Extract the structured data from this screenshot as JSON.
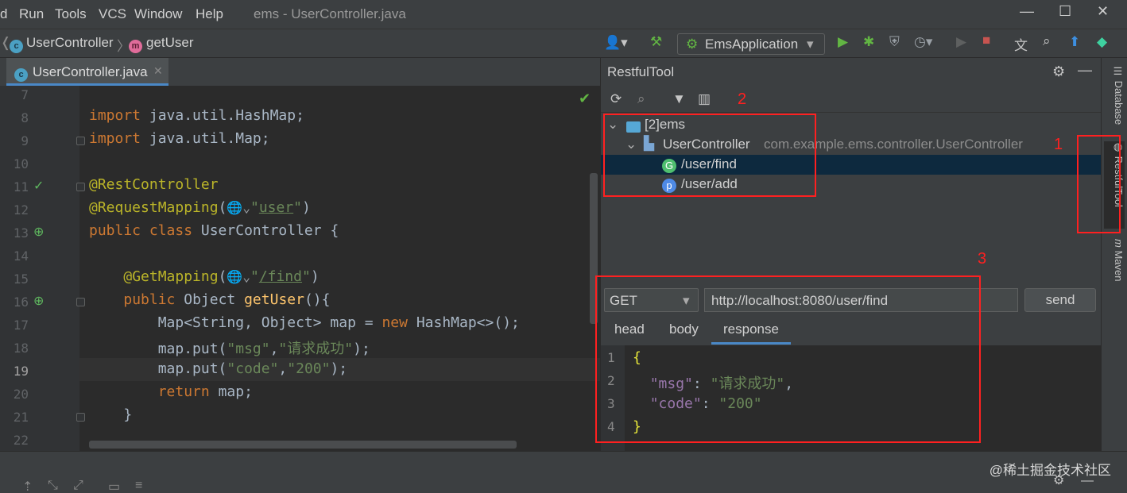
{
  "menu": {
    "items": [
      "d",
      "Run",
      "Tools",
      "VCS",
      "Window",
      "Help"
    ],
    "window_title": "ems - UserController.java"
  },
  "nav": {
    "breadcrumb_class": "UserController",
    "breadcrumb_method": "getUser",
    "run_config": "EmsApplication"
  },
  "editor": {
    "tab": "UserController.java",
    "line_numbers": [
      "7",
      "8",
      "9",
      "10",
      "11",
      "12",
      "13",
      "14",
      "15",
      "16",
      "17",
      "18",
      "19",
      "20",
      "21",
      "22"
    ]
  },
  "restful": {
    "title": "RestfulTool",
    "tree": {
      "project": "[2]ems",
      "controller": "UserController",
      "controller_pkg": "com.example.ems.controller.UserController",
      "endpoints": [
        {
          "badge": "G",
          "path": "/user/find"
        },
        {
          "badge": "p",
          "path": "/user/add"
        }
      ]
    },
    "request": {
      "method": "GET",
      "url": "http://localhost:8080/user/find",
      "send_label": "send",
      "tabs": [
        "head",
        "body",
        "response"
      ]
    },
    "response_line_numbers": [
      "1",
      "2",
      "3",
      "4"
    ]
  },
  "sidebar": {
    "tabs": [
      "Database",
      "RestfulTool",
      "Maven"
    ]
  },
  "annotations": [
    "1",
    "2",
    "3"
  ],
  "watermark": "@稀土掘金技术社区",
  "colors": {
    "accent": "#4a88c7",
    "annotation": "#ff2020",
    "selection": "#0d293e"
  }
}
